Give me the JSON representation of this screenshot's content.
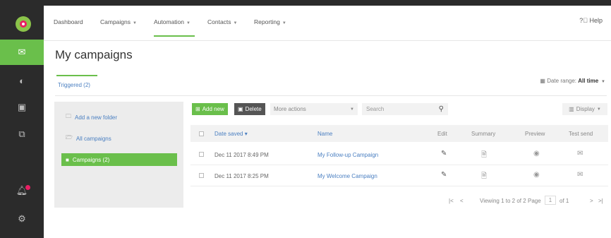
{
  "nav": {
    "items": [
      {
        "label": "Dashboard",
        "caret": false
      },
      {
        "label": "Campaigns",
        "caret": true
      },
      {
        "label": "Automation",
        "caret": true
      },
      {
        "label": "Contacts",
        "caret": true
      },
      {
        "label": "Reporting",
        "caret": true
      }
    ],
    "help_label": "Help"
  },
  "page": {
    "title": "My campaigns",
    "tab_label": "Triggered (2)",
    "date_range_label": "Date range:",
    "date_range_value": "All time"
  },
  "folders": {
    "items": [
      {
        "label": "Add a new folder",
        "icon": "add-folder-icon"
      },
      {
        "label": "All campaigns",
        "icon": "folders-icon"
      },
      {
        "label": "Campaigns (2)",
        "icon": "folder-icon",
        "selected": true
      }
    ]
  },
  "toolbar": {
    "add_label": "Add new",
    "delete_label": "Delete",
    "more_actions_label": "More actions",
    "search_placeholder": "Search",
    "display_label": "Display"
  },
  "table": {
    "columns": [
      "Date saved",
      "Name",
      "Edit",
      "Summary",
      "Preview",
      "Test send"
    ],
    "rows": [
      {
        "date": "Dec 11 2017 8:49 PM",
        "name": "My Follow-up Campaign"
      },
      {
        "date": "Dec 11 2017 8:25 PM",
        "name": "My Welcome Campaign"
      }
    ]
  },
  "pager": {
    "viewing": "Viewing 1 to 2 of 2",
    "page_label": "Page",
    "page_value": "1",
    "of_label": "of 1"
  },
  "colors": {
    "accent": "#6abf4b",
    "rail": "#2b2b2b",
    "link": "#4a7fc1",
    "badge": "#e91e63"
  }
}
